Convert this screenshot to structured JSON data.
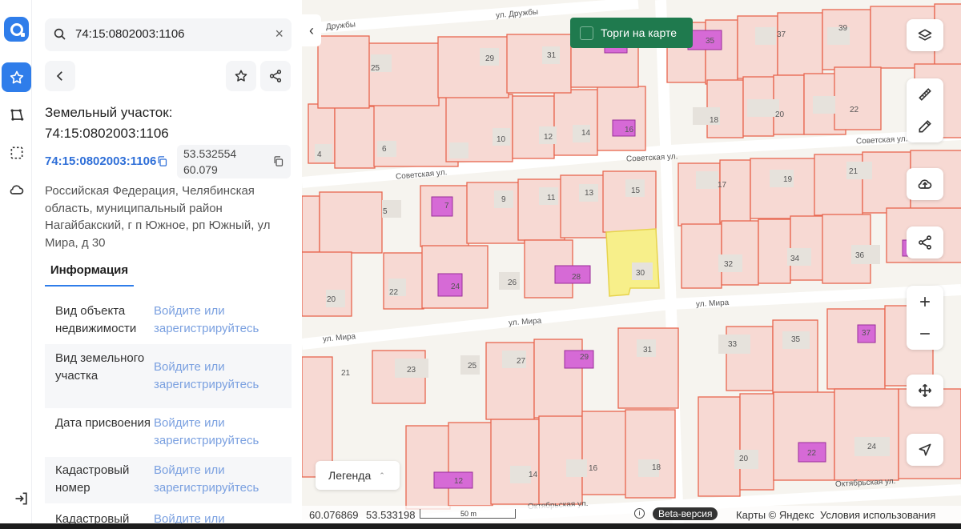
{
  "search": {
    "query": "74:15:0802003:1106"
  },
  "parcel": {
    "title": "Земельный участок:",
    "title_number": "74:15:0802003:1106",
    "cadastral_link": "74:15:0802003:1106",
    "lat": "53.532554",
    "lon": "60.079",
    "address": "Российская Федерация, Челябинская область, муниципальный район Нагайбакский, г п Южное, рп Южный, ул Мира, д 30"
  },
  "tabs": {
    "info": "Информация"
  },
  "info_rows": [
    {
      "label": "Вид объекта недвижимости",
      "value": "Войдите или зарегистрируйтесь"
    },
    {
      "label": "Вид земельного участка",
      "value": "Войдите или зарегистрируйтесь"
    },
    {
      "label": "Дата присвоения",
      "value": "Войдите или зарегистрируйтесь"
    },
    {
      "label": "Кадастровый номер",
      "value": "Войдите или зарегистрируйтесь"
    },
    {
      "label": "Кадастровый",
      "value": "Войдите или"
    }
  ],
  "map": {
    "torgi_label": "Торги на карте",
    "legend_label": "Легенда",
    "cursor_lon": "60.076869",
    "cursor_lat": "53.533198",
    "scale_label": "50 m",
    "beta_label": "Beta-версия",
    "credit": "Карты © Яндекс",
    "terms": "Условия использования",
    "streets": {
      "druzhby_top": "ул. Дружбы",
      "druzhby_left": "Дружбы",
      "sovetskaya_left": "Советская ул.",
      "sovetskaya_mid": "Советская ул.",
      "sovetskaya_right": "Советская ул.",
      "mira_left": "ул. Мира",
      "mira_mid": "ул. Мира",
      "mira_right": "ул. Мира",
      "oktyabrskaya_mid": "Октябрьская ул.",
      "oktyabrskaya_right": "Октябрьская ул."
    },
    "house_numbers": [
      "25",
      "29",
      "31",
      "35",
      "37",
      "39",
      "4",
      "6",
      "10",
      "12",
      "14",
      "16",
      "18",
      "20",
      "22",
      "5",
      "7",
      "9",
      "11",
      "13",
      "15",
      "17",
      "19",
      "21",
      "20",
      "22",
      "24",
      "26",
      "28",
      "30",
      "32",
      "34",
      "36",
      "21",
      "23",
      "25",
      "27",
      "29",
      "31",
      "33",
      "35",
      "37",
      "12",
      "14",
      "16",
      "18",
      "20",
      "22",
      "24"
    ]
  },
  "colors": {
    "accent": "#2f7dea",
    "parcel_fill": "#f7d9d3",
    "parcel_stroke": "#e8664f",
    "selected": "#f7ef8a",
    "building": "#d66ad6",
    "torgi_bg": "#1f7a4e"
  }
}
